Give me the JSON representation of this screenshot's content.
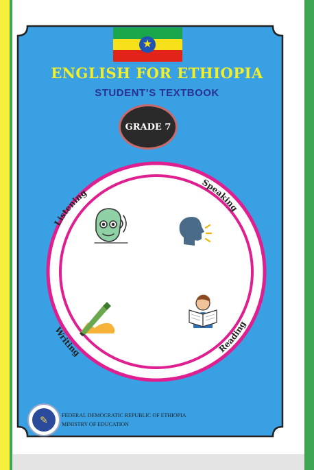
{
  "book": {
    "title": "ENGLISH FOR ETHIOPIA",
    "subtitle": "STUDENT’S TEXTBOOK",
    "grade": "GRADE 7"
  },
  "skills": {
    "listening": "Listening",
    "speaking": "Speaking",
    "writing": "Writing",
    "reading": "Reading"
  },
  "footer": {
    "line1": "FEDERAL DEMOCRATIC REPUBLIC OF ETHIOPIA",
    "line2": "MINISTRY OF EDUCATION"
  },
  "colors": {
    "cover_blue": "#3aa0e4",
    "ring_magenta": "#df1e8f",
    "title_yellow": "#f3ee2a",
    "subtitle_navy": "#2a2f94",
    "flag_green": "#1aa64a",
    "flag_yellow": "#f6e11b",
    "flag_red": "#e2231a"
  },
  "icons": {
    "flag": "ethiopia-flag-icon",
    "listening": "listening-face-icon",
    "speaking": "speaking-head-icon",
    "writing": "pen-writing-icon",
    "reading": "reading-person-icon",
    "seal": "ministry-seal-icon"
  }
}
